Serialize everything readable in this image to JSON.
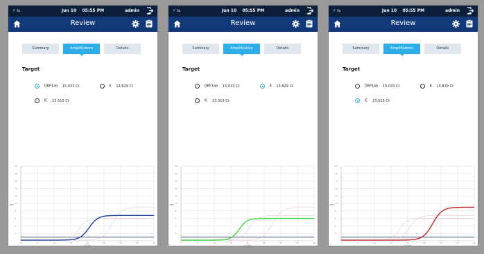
{
  "status_bar": {
    "date": "Jun 10",
    "time": "05:55 PM",
    "user": "admin"
  },
  "nav": {
    "title": "Review"
  },
  "tabs": [
    "Summary",
    "Amplification",
    "Details"
  ],
  "active_tab": "Amplification",
  "target_heading": "Target",
  "targets": [
    {
      "label": "ORF1ab",
      "ct": "15.033 Ct",
      "color": "#1f3d9e"
    },
    {
      "label": "E",
      "ct": "13.829 Ct",
      "color": "#3ed63a"
    },
    {
      "label": "IC",
      "ct": "23.515 Ct",
      "color": "#c0272d"
    }
  ],
  "panels": [
    {
      "selected_target": "ORF1ab"
    },
    {
      "selected_target": "E"
    },
    {
      "selected_target": "IC"
    }
  ],
  "chart_data": {
    "type": "line",
    "ylabel": "RFU",
    "xlabel": "Cycles",
    "x_ticks": [
      "0",
      "5",
      "10",
      "15",
      "20",
      "25",
      "30",
      "35",
      "40"
    ],
    "y_ticks": [
      "20",
      "18",
      "16",
      "14",
      "12",
      "10",
      "8",
      "6",
      "4",
      "2"
    ],
    "xlim": [
      0,
      40
    ],
    "ylim": [
      0,
      20
    ],
    "grid": true,
    "series": [
      {
        "target": "ORF1ab",
        "color": "#1f3d9e",
        "baseline": 0.2,
        "plateau": 6.8,
        "midpoint": 20.5,
        "slope": 0.75
      },
      {
        "target": "E",
        "color": "#3ed63a",
        "baseline": 0.2,
        "plateau": 6.0,
        "midpoint": 17.5,
        "slope": 0.85
      },
      {
        "target": "IC",
        "color": "#c0272d",
        "baseline": 0.2,
        "plateau": 9.0,
        "midpoint": 27.5,
        "slope": 0.7
      }
    ],
    "threshold": 1.0,
    "threshold_color": "#1f2f80"
  }
}
